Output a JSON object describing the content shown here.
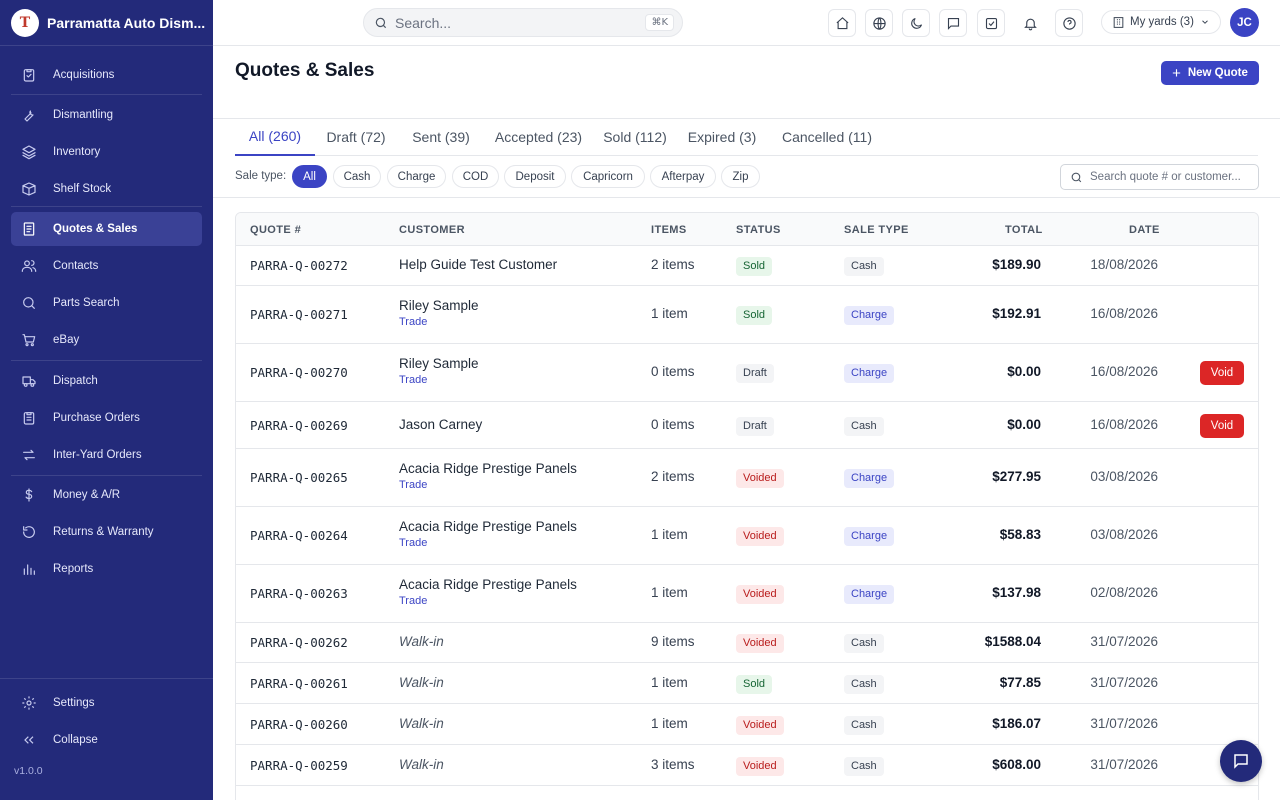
{
  "app": {
    "name": "Parramatta Auto Dism...",
    "logo_letter": "T",
    "version": "v1.0.0"
  },
  "sidebar": {
    "items": [
      {
        "label": "Acquisitions",
        "icon": "clipboard-icon"
      },
      {
        "label": "Dismantling",
        "icon": "wrench-icon"
      },
      {
        "label": "Inventory",
        "icon": "layers-icon"
      },
      {
        "label": "Shelf Stock",
        "icon": "box-icon"
      },
      {
        "label": "Quotes & Sales",
        "icon": "receipt-icon",
        "active": true
      },
      {
        "label": "Contacts",
        "icon": "users-icon"
      },
      {
        "label": "Parts Search",
        "icon": "search-icon"
      },
      {
        "label": "eBay",
        "icon": "cart-icon"
      },
      {
        "label": "Dispatch",
        "icon": "truck-icon"
      },
      {
        "label": "Purchase Orders",
        "icon": "clipboard-list-icon"
      },
      {
        "label": "Inter-Yard Orders",
        "icon": "arrows-icon"
      },
      {
        "label": "Money & A/R",
        "icon": "dollar-icon"
      },
      {
        "label": "Returns & Warranty",
        "icon": "rotate-icon"
      },
      {
        "label": "Reports",
        "icon": "bar-chart-icon"
      }
    ],
    "settings_label": "Settings",
    "collapse_label": "Collapse"
  },
  "topbar": {
    "search_placeholder": "Search...",
    "shortcut": "⌘K",
    "yards_label": "My yards (3)",
    "avatar_initials": "JC"
  },
  "page": {
    "title": "Quotes & Sales",
    "new_button": "New Quote"
  },
  "tabs": [
    {
      "label": "All (260)",
      "active": true
    },
    {
      "label": "Draft (72)"
    },
    {
      "label": "Sent (39)"
    },
    {
      "label": "Accepted (23)"
    },
    {
      "label": "Sold (112)"
    },
    {
      "label": "Expired (3)"
    },
    {
      "label": "Cancelled (11)"
    }
  ],
  "filters": {
    "label": "Sale type:",
    "chips": [
      "All",
      "Cash",
      "Charge",
      "COD",
      "Deposit",
      "Capricorn",
      "Afterpay",
      "Zip"
    ],
    "search_placeholder": "Search quote # or customer..."
  },
  "table": {
    "headers": [
      "QUOTE #",
      "CUSTOMER",
      "ITEMS",
      "STATUS",
      "SALE TYPE",
      "TOTAL",
      "DATE"
    ],
    "rows": [
      {
        "quote": "PARRA-Q-00272",
        "customer": "Help Guide Test Customer",
        "sub": "",
        "items": "2 items",
        "status": "Sold",
        "sale_type": "Cash",
        "total": "$189.90",
        "date": "18/08/2026",
        "action": ""
      },
      {
        "quote": "PARRA-Q-00271",
        "customer": "Riley Sample",
        "sub": "Trade",
        "items": "1 item",
        "status": "Sold",
        "sale_type": "Charge",
        "total": "$192.91",
        "date": "16/08/2026",
        "action": ""
      },
      {
        "quote": "PARRA-Q-00270",
        "customer": "Riley Sample",
        "sub": "Trade",
        "items": "0 items",
        "status": "Draft",
        "sale_type": "Charge",
        "total": "$0.00",
        "date": "16/08/2026",
        "action": "Void"
      },
      {
        "quote": "PARRA-Q-00269",
        "customer": "Jason Carney",
        "sub": "",
        "items": "0 items",
        "status": "Draft",
        "sale_type": "Cash",
        "total": "$0.00",
        "date": "16/08/2026",
        "action": "Void"
      },
      {
        "quote": "PARRA-Q-00265",
        "customer": "Acacia Ridge Prestige Panels",
        "sub": "Trade",
        "items": "2 items",
        "status": "Voided",
        "sale_type": "Charge",
        "total": "$277.95",
        "date": "03/08/2026",
        "action": ""
      },
      {
        "quote": "PARRA-Q-00264",
        "customer": "Acacia Ridge Prestige Panels",
        "sub": "Trade",
        "items": "1 item",
        "status": "Voided",
        "sale_type": "Charge",
        "total": "$58.83",
        "date": "03/08/2026",
        "action": ""
      },
      {
        "quote": "PARRA-Q-00263",
        "customer": "Acacia Ridge Prestige Panels",
        "sub": "Trade",
        "items": "1 item",
        "status": "Voided",
        "sale_type": "Charge",
        "total": "$137.98",
        "date": "02/08/2026",
        "action": ""
      },
      {
        "quote": "PARRA-Q-00262",
        "customer": "Walk-in",
        "sub": "",
        "walkin": true,
        "items": "9 items",
        "status": "Voided",
        "sale_type": "Cash",
        "total": "$1588.04",
        "date": "31/07/2026",
        "action": ""
      },
      {
        "quote": "PARRA-Q-00261",
        "customer": "Walk-in",
        "sub": "",
        "walkin": true,
        "items": "1 item",
        "status": "Sold",
        "sale_type": "Cash",
        "total": "$77.85",
        "date": "31/07/2026",
        "action": ""
      },
      {
        "quote": "PARRA-Q-00260",
        "customer": "Walk-in",
        "sub": "",
        "walkin": true,
        "items": "1 item",
        "status": "Voided",
        "sale_type": "Cash",
        "total": "$186.07",
        "date": "31/07/2026",
        "action": ""
      },
      {
        "quote": "PARRA-Q-00259",
        "customer": "Walk-in",
        "sub": "",
        "walkin": true,
        "items": "3 items",
        "status": "Voided",
        "sale_type": "Cash",
        "total": "$608.00",
        "date": "31/07/2026",
        "action": ""
      }
    ]
  },
  "colors": {
    "sidebar": "#232a7a",
    "accent": "#3b44c4",
    "danger": "#dc2626"
  }
}
